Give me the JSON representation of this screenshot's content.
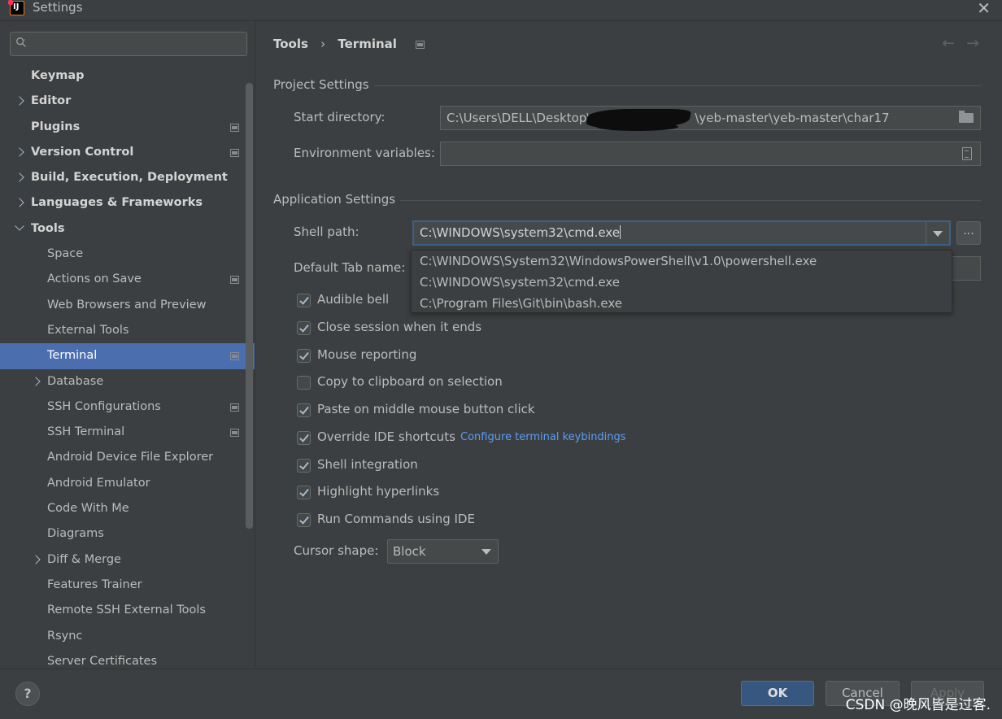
{
  "window": {
    "title": "Settings",
    "icon_name": "intellij-idea-icon"
  },
  "sidebar": {
    "search": {
      "value": "",
      "placeholder": ""
    },
    "items": [
      {
        "label": "Keymap",
        "bold": true,
        "expandable": false,
        "level": 0,
        "project": false
      },
      {
        "label": "Editor",
        "bold": true,
        "expandable": true,
        "expanded": false,
        "level": 0,
        "project": false
      },
      {
        "label": "Plugins",
        "bold": true,
        "expandable": false,
        "level": 0,
        "project": true
      },
      {
        "label": "Version Control",
        "bold": true,
        "expandable": true,
        "expanded": false,
        "level": 0,
        "project": true
      },
      {
        "label": "Build, Execution, Deployment",
        "bold": true,
        "expandable": true,
        "expanded": false,
        "level": 0,
        "project": false
      },
      {
        "label": "Languages & Frameworks",
        "bold": true,
        "expandable": true,
        "expanded": false,
        "level": 0,
        "project": false
      },
      {
        "label": "Tools",
        "bold": true,
        "expandable": true,
        "expanded": true,
        "level": 0,
        "project": false
      },
      {
        "label": "Space",
        "bold": false,
        "expandable": false,
        "level": 1,
        "project": false
      },
      {
        "label": "Actions on Save",
        "bold": false,
        "expandable": false,
        "level": 1,
        "project": true
      },
      {
        "label": "Web Browsers and Preview",
        "bold": false,
        "expandable": false,
        "level": 1,
        "project": false
      },
      {
        "label": "External Tools",
        "bold": false,
        "expandable": false,
        "level": 1,
        "project": false
      },
      {
        "label": "Terminal",
        "bold": false,
        "expandable": false,
        "level": 1,
        "project": true,
        "selected": true
      },
      {
        "label": "Database",
        "bold": false,
        "expandable": true,
        "expanded": false,
        "level": 1,
        "project": false
      },
      {
        "label": "SSH Configurations",
        "bold": false,
        "expandable": false,
        "level": 1,
        "project": true
      },
      {
        "label": "SSH Terminal",
        "bold": false,
        "expandable": false,
        "level": 1,
        "project": true
      },
      {
        "label": "Android Device File Explorer",
        "bold": false,
        "expandable": false,
        "level": 1,
        "project": false
      },
      {
        "label": "Android Emulator",
        "bold": false,
        "expandable": false,
        "level": 1,
        "project": false
      },
      {
        "label": "Code With Me",
        "bold": false,
        "expandable": false,
        "level": 1,
        "project": false
      },
      {
        "label": "Diagrams",
        "bold": false,
        "expandable": false,
        "level": 1,
        "project": false
      },
      {
        "label": "Diff & Merge",
        "bold": false,
        "expandable": true,
        "expanded": false,
        "level": 1,
        "project": false
      },
      {
        "label": "Features Trainer",
        "bold": false,
        "expandable": false,
        "level": 1,
        "project": false
      },
      {
        "label": "Remote SSH External Tools",
        "bold": false,
        "expandable": false,
        "level": 1,
        "project": false
      },
      {
        "label": "Rsync",
        "bold": false,
        "expandable": false,
        "level": 1,
        "project": false
      },
      {
        "label": "Server Certificates",
        "bold": false,
        "expandable": false,
        "level": 1,
        "project": false
      }
    ]
  },
  "breadcrumb": {
    "parent": "Tools",
    "separator": "›",
    "current": "Terminal",
    "back": "←",
    "forward": "→"
  },
  "project_settings": {
    "title": "Project Settings",
    "start_directory": {
      "label": "Start directory:",
      "value_prefix": "C:\\Users\\DELL\\Desktop\\",
      "value_suffix": "\\yeb-master\\yeb-master\\char17"
    },
    "env_vars": {
      "label": "Environment variables:",
      "value": ""
    }
  },
  "application_settings": {
    "title": "Application Settings",
    "shell_path": {
      "label": "Shell path:",
      "value": "C:\\WINDOWS\\system32\\cmd.exe",
      "browse_label": "...",
      "options": [
        "C:\\WINDOWS\\System32\\WindowsPowerShell\\v1.0\\powershell.exe",
        "C:\\WINDOWS\\system32\\cmd.exe",
        "C:\\Program Files\\Git\\bin\\bash.exe"
      ]
    },
    "default_tab_name": {
      "label": "Default Tab name:"
    },
    "checkboxes": [
      {
        "label": "Audible bell",
        "checked": true
      },
      {
        "label": "Close session when it ends",
        "checked": true
      },
      {
        "label": "Mouse reporting",
        "checked": true
      },
      {
        "label": "Copy to clipboard on selection",
        "checked": false
      },
      {
        "label": "Paste on middle mouse button click",
        "checked": true
      },
      {
        "label": "Override IDE shortcuts",
        "checked": true
      },
      {
        "label": "Shell integration",
        "checked": true
      },
      {
        "label": "Highlight hyperlinks",
        "checked": true
      },
      {
        "label": "Run Commands using IDE",
        "checked": true
      }
    ],
    "keybindings_link": "Configure terminal keybindings",
    "cursor_shape": {
      "label": "Cursor shape:",
      "value": "Block"
    }
  },
  "footer": {
    "help_label": "?",
    "ok_label": "OK",
    "cancel_label": "Cancel",
    "apply_label": "Apply",
    "watermark": "CSDN @晚风皆是过客."
  },
  "colors": {
    "background": "#3c3f41",
    "selection": "#4b6eaf",
    "link": "#589df6",
    "ok_button": "#365880"
  }
}
